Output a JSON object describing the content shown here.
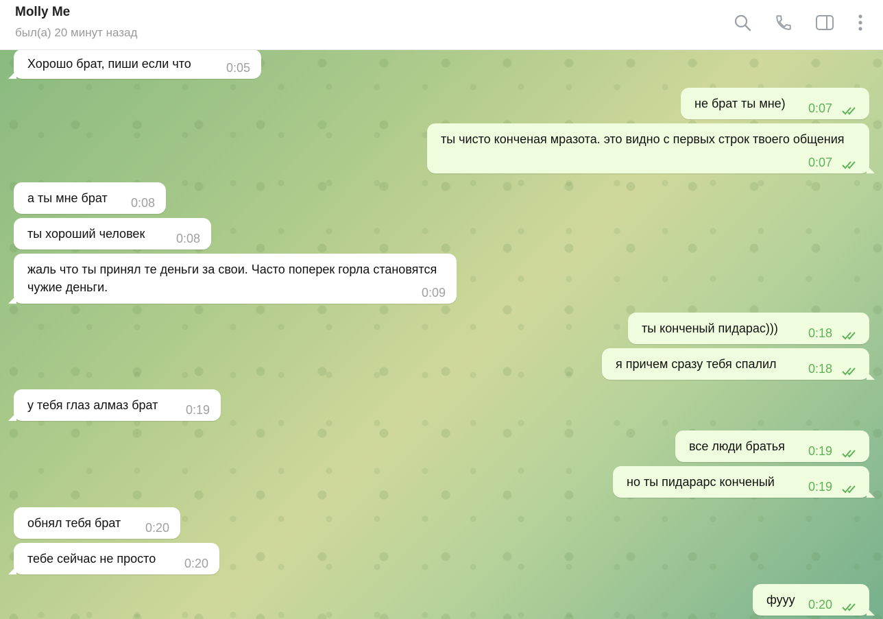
{
  "header": {
    "name": "Molly Me",
    "status": "был(а) 20 минут назад",
    "icons": [
      "search-icon",
      "phone-icon",
      "sidebar-toggle-icon",
      "more-vertical-icon"
    ]
  },
  "messages": [
    {
      "dir": "in",
      "text": "Хорошо брат, пиши если что",
      "time": "0:05"
    },
    {
      "dir": "out",
      "text": "не брат ты мне)",
      "time": "0:07",
      "read": true
    },
    {
      "dir": "out",
      "text": "ты чисто конченая мразота. это видно с первых строк твоего общения",
      "time": "0:07",
      "read": true
    },
    {
      "dir": "in",
      "text": "а ты мне брат",
      "time": "0:08"
    },
    {
      "dir": "in",
      "text": "ты хороший человек",
      "time": "0:08"
    },
    {
      "dir": "in",
      "text": "жаль что ты принял те деньги за свои. Часто поперек горла становятся чужие деньги.",
      "time": "0:09"
    },
    {
      "dir": "out",
      "text": "ты конченый пидарас)))",
      "time": "0:18",
      "read": true
    },
    {
      "dir": "out",
      "text": "я причем сразу тебя спалил",
      "time": "0:18",
      "read": true
    },
    {
      "dir": "in",
      "text": "у тебя глаз алмаз брат",
      "time": "0:19"
    },
    {
      "dir": "out",
      "text": "все люди братья",
      "time": "0:19",
      "read": true
    },
    {
      "dir": "out",
      "text": "но ты пидарарс конченый",
      "time": "0:19",
      "read": true
    },
    {
      "dir": "in",
      "text": "обнял тебя брат",
      "time": "0:20"
    },
    {
      "dir": "in",
      "text": "тебе сейчас не просто",
      "time": "0:20"
    },
    {
      "dir": "out",
      "text": "фууу",
      "time": "0:20",
      "read": true
    }
  ],
  "colors": {
    "incoming_bubble": "#ffffff",
    "outgoing_bubble": "#effdde",
    "outgoing_time": "#5fb157",
    "incoming_time": "#a0a0a0"
  }
}
